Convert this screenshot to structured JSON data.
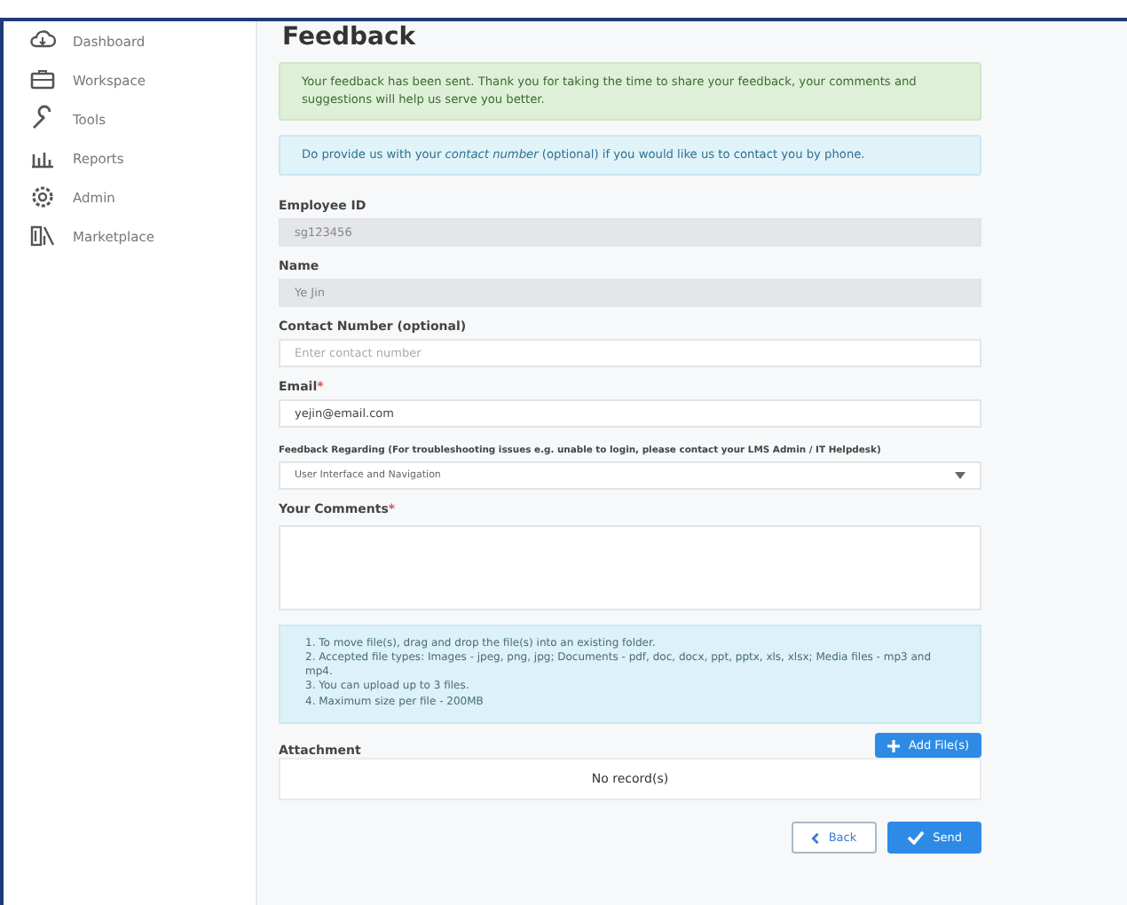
{
  "sidebar": {
    "items": [
      {
        "label": "Dashboard"
      },
      {
        "label": "Workspace"
      },
      {
        "label": "Tools"
      },
      {
        "label": "Reports"
      },
      {
        "label": "Admin"
      },
      {
        "label": "Marketplace"
      }
    ]
  },
  "page_title": "Feedback",
  "alerts": [
    {
      "kind": "success",
      "text": "Your feedback has been sent. Thank you for taking the time to share your feedback, your comments and suggestions will help us serve you better."
    },
    {
      "kind": "info",
      "text": "Do provide us with your *contact number* (optional) if you would like us to contact you by phone."
    }
  ],
  "fields": [
    {
      "kind": "readonly",
      "label": "Employee ID",
      "value": "sg123456"
    },
    {
      "kind": "readonly",
      "label": "Name",
      "value": "Ye Jin"
    },
    {
      "kind": "text",
      "label": "Contact Number (optional)",
      "placeholder": "Enter contact number"
    },
    {
      "kind": "text",
      "label": "Email",
      "required_mark": "*",
      "value": "yejin@email.com"
    },
    {
      "kind": "select",
      "label": "Feedback Regarding (For troubleshooting issues e.g. unable to login, please contact your LMS Admin / IT Helpdesk)",
      "value": "User Interface and Navigation"
    },
    {
      "kind": "textarea",
      "label": "Your Comments",
      "required_mark": "*"
    }
  ],
  "upload_notes": [
    "1. To move file(s), drag and drop the file(s) into an existing folder.",
    "2. Accepted file types: Images - jpeg, png, jpg; Documents - pdf, doc, docx, ppt, pptx, xls, xlsx; Media files - mp3 and mp4.",
    "3. You can upload up to 3 files.",
    "4. Maximum size per file - 200MB"
  ],
  "attachment": {
    "label": "Attachment",
    "add_button": "Add File(s)",
    "empty_text": "No record(s)"
  },
  "buttons": [
    {
      "kind": "back",
      "label": "Back"
    },
    {
      "kind": "send",
      "label": "Send"
    }
  ]
}
